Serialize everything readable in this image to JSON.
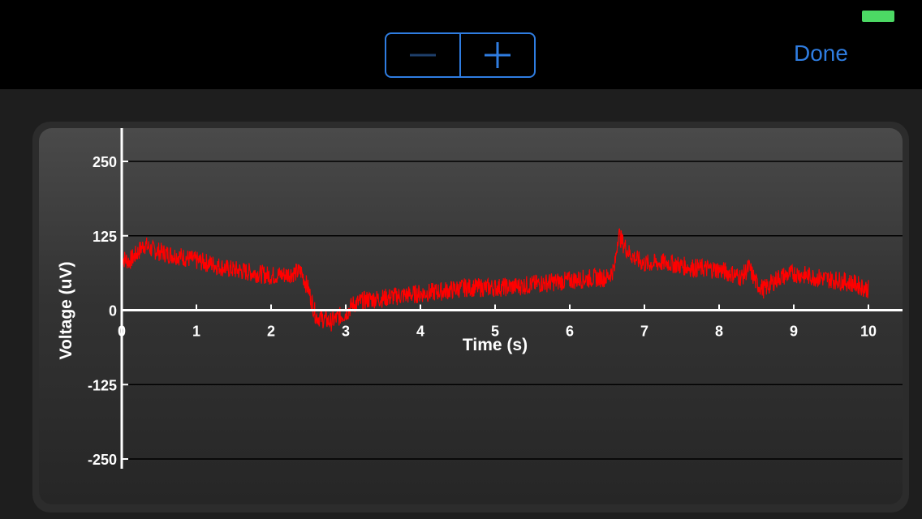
{
  "toolbar": {
    "zoom_out_icon": "minus-icon",
    "zoom_in_icon": "plus-icon",
    "done_label": "Done",
    "accent_color": "#2f7de1"
  },
  "status": {
    "battery_color": "#4cd964"
  },
  "chart_data": {
    "type": "line",
    "xlabel": "Time (s)",
    "ylabel": "Voltage (uV)",
    "xlim": [
      0,
      10
    ],
    "ylim": [
      -250,
      250
    ],
    "x_ticks": [
      0,
      1,
      2,
      3,
      4,
      5,
      6,
      7,
      8,
      9,
      10
    ],
    "y_ticks": [
      250,
      125,
      0,
      -125,
      -250
    ],
    "y_tick_labels": [
      "250",
      "125",
      "0",
      "-125",
      "-250"
    ],
    "grid": true,
    "series": [
      {
        "color": "#ff0000",
        "x": [
          0.0,
          0.1,
          0.2,
          0.3,
          0.4,
          0.6,
          0.8,
          1.0,
          1.2,
          1.4,
          1.6,
          1.8,
          2.0,
          2.2,
          2.4,
          2.5,
          2.6,
          2.7,
          2.8,
          2.9,
          3.0,
          3.1,
          3.3,
          3.5,
          3.7,
          4.0,
          4.3,
          4.6,
          5.0,
          5.3,
          5.6,
          6.0,
          6.3,
          6.5,
          6.6,
          6.65,
          6.7,
          6.8,
          6.9,
          7.0,
          7.3,
          7.6,
          8.0,
          8.2,
          8.3,
          8.4,
          8.5,
          8.6,
          8.8,
          9.0,
          9.3,
          9.6,
          9.8,
          10.0
        ],
        "y": [
          88,
          82,
          95,
          110,
          102,
          95,
          90,
          83,
          78,
          70,
          66,
          62,
          58,
          60,
          65,
          35,
          -10,
          -15,
          -20,
          -12,
          -5,
          10,
          18,
          20,
          24,
          28,
          32,
          38,
          38,
          40,
          45,
          50,
          54,
          55,
          70,
          130,
          115,
          95,
          85,
          78,
          80,
          72,
          68,
          60,
          55,
          72,
          45,
          35,
          55,
          62,
          55,
          50,
          45,
          35
        ]
      }
    ]
  }
}
